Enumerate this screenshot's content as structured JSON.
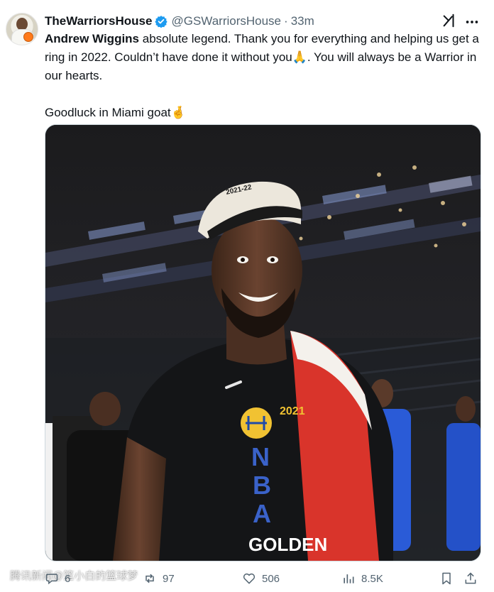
{
  "tweet": {
    "author_name": "TheWarriorsHouse",
    "handle": "@GSWarriorsHouse",
    "separator": "·",
    "time": "33m",
    "text_mention": "Andrew Wiggins",
    "text_line1": " absolute legend. Thank you for everything and helping us get a ring in 2022. Couldn’t have done it without you🙏. You will always be a Warrior in our hearts.",
    "text_line2": "Goodluck in Miami goat🤞",
    "photo_text": {
      "cap_year": "2021-22",
      "shirt_year": "2021",
      "shirt_nba": [
        "N",
        "B",
        "A"
      ],
      "shirt_golden": "GOLDEN"
    }
  },
  "actions": {
    "replies": "6",
    "reposts": "97",
    "likes": "506",
    "views": "8.5K"
  },
  "watermark": "腾讯新闻@篮小白的篮球梦",
  "colors": {
    "verified": "#1d9bf0",
    "muted": "#536471",
    "text": "#0f1419"
  }
}
